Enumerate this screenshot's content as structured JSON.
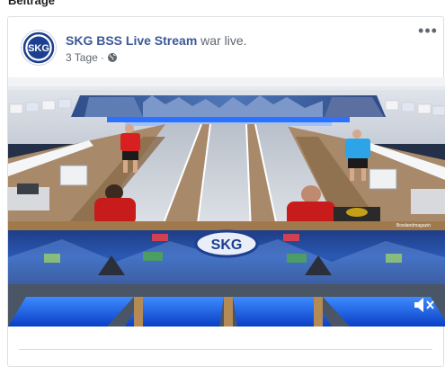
{
  "section": {
    "title": "Beiträge"
  },
  "post": {
    "page_name": "SKG BSS Live Stream",
    "action_text": " war live.",
    "time_ago": "3 Tage",
    "separator": "·",
    "privacy_icon": "globe-icon",
    "more_icon": "more-horizontal-icon",
    "more_label": "•••",
    "avatar": {
      "logo_text": "SKG",
      "ring_color": "#1d3f8f"
    },
    "video": {
      "banner_logo_text": "SKG",
      "player_badge": "Bowlandmagazin",
      "mute_icon": "volume-mute-icon"
    }
  },
  "colors": {
    "link": "#3b5998",
    "meta": "#616770",
    "border": "#dddfe2",
    "lane_blue": "#1e6cff"
  }
}
